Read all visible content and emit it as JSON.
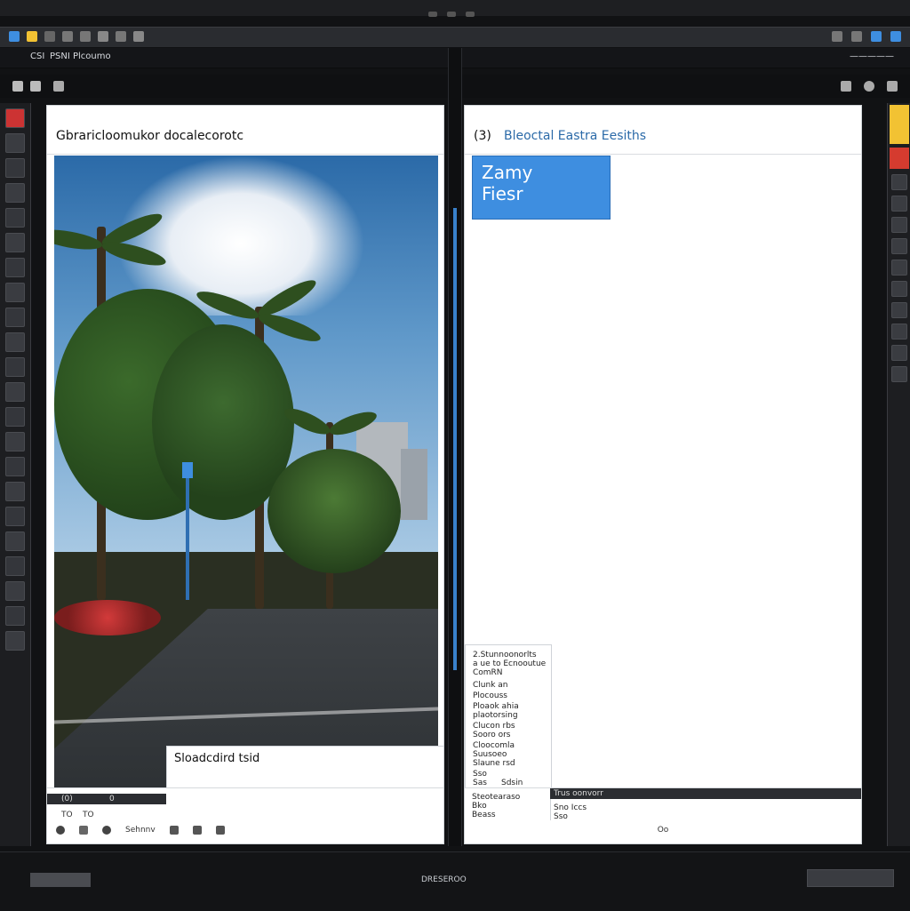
{
  "window": {
    "title": "",
    "status_center": "DRESEROO"
  },
  "top_bar": {
    "left_label": "CSI",
    "left_label_2": "PSNI Plcoumo",
    "right_label": "—————"
  },
  "panel_left": {
    "header": "Gbraricloomukor docalecorotc",
    "caption": "Sloadcdird tsid",
    "footer_meta_1": "(0)",
    "footer_meta_2": "0",
    "footer_meta_3": "TO",
    "footer_meta_4": "TO",
    "footer_bar": "Sehnnv"
  },
  "panel_right": {
    "header_code": "(3)",
    "header": "Bleoctal Eastra Eesiths",
    "badge_line_1": "Zamy",
    "badge_line_2": "Fiesr",
    "side_notes": [
      "2.Stunnoonorlts",
      "a ue to Ecnooutue",
      "ComRN",
      "Clunk an",
      "Plocouss",
      "Ploaok ahia",
      "plaotorsing",
      "Clucon rbs",
      "Sooro ors",
      "Cloocomla",
      "Suusoeo",
      "Slaune rsd",
      "Sso",
      "Sas",
      "Sdsin"
    ],
    "footer_left_1": "Steotearaso",
    "footer_left_2": "Bko",
    "footer_left_3": "Beass",
    "footer_right_1": "Trus oonvorr",
    "footer_right_2": "Sno Iccs",
    "footer_right_3": "Sso",
    "footer_center": "Oo"
  },
  "colors": {
    "accent_blue": "#3e8ee0",
    "accent_yellow": "#f2c233",
    "accent_red": "#d53b2f"
  }
}
